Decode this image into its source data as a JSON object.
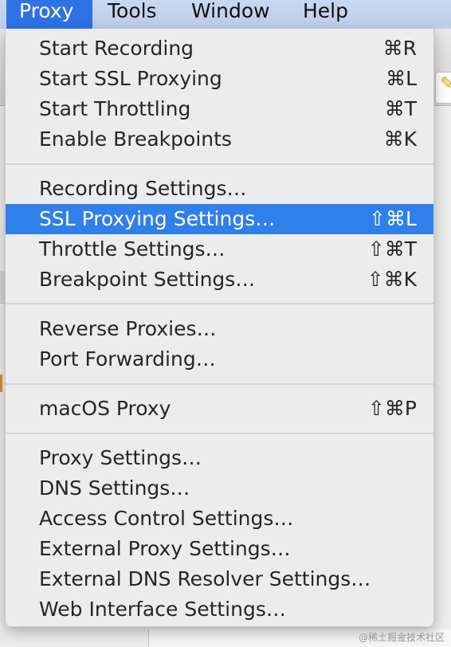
{
  "menubar": {
    "items": [
      "Proxy",
      "Tools",
      "Window",
      "Help"
    ]
  },
  "menu": {
    "start_recording": {
      "label": "Start Recording",
      "shortcut": "⌘R"
    },
    "start_ssl_proxying": {
      "label": "Start SSL Proxying",
      "shortcut": "⌘L"
    },
    "start_throttling": {
      "label": "Start Throttling",
      "shortcut": "⌘T"
    },
    "enable_breakpoints": {
      "label": "Enable Breakpoints",
      "shortcut": "⌘K"
    },
    "recording_settings": {
      "label": "Recording Settings…",
      "shortcut": ""
    },
    "ssl_proxying_settings": {
      "label": "SSL Proxying Settings…",
      "shortcut": "⇧⌘L"
    },
    "throttle_settings": {
      "label": "Throttle Settings…",
      "shortcut": "⇧⌘T"
    },
    "breakpoint_settings": {
      "label": "Breakpoint Settings…",
      "shortcut": "⇧⌘K"
    },
    "reverse_proxies": {
      "label": "Reverse Proxies…",
      "shortcut": ""
    },
    "port_forwarding": {
      "label": "Port Forwarding…",
      "shortcut": ""
    },
    "macos_proxy": {
      "label": "macOS Proxy",
      "shortcut": "⇧⌘P"
    },
    "proxy_settings": {
      "label": "Proxy Settings…",
      "shortcut": ""
    },
    "dns_settings": {
      "label": "DNS Settings…",
      "shortcut": ""
    },
    "access_control_settings": {
      "label": "Access Control Settings…",
      "shortcut": ""
    },
    "external_proxy_settings": {
      "label": "External Proxy Settings…",
      "shortcut": ""
    },
    "external_dns_resolver_settings": {
      "label": "External DNS Resolver Settings…",
      "shortcut": ""
    },
    "web_interface_settings": {
      "label": "Web Interface Settings…",
      "shortcut": ""
    }
  },
  "watermark": "@稀土掘金技术社区",
  "colors": {
    "highlight": "#2f80ea",
    "menubar_active": "#2e73e6",
    "menu_background": "#ececec"
  },
  "icons": {
    "background_toolbar": "magic-wand-icon"
  }
}
